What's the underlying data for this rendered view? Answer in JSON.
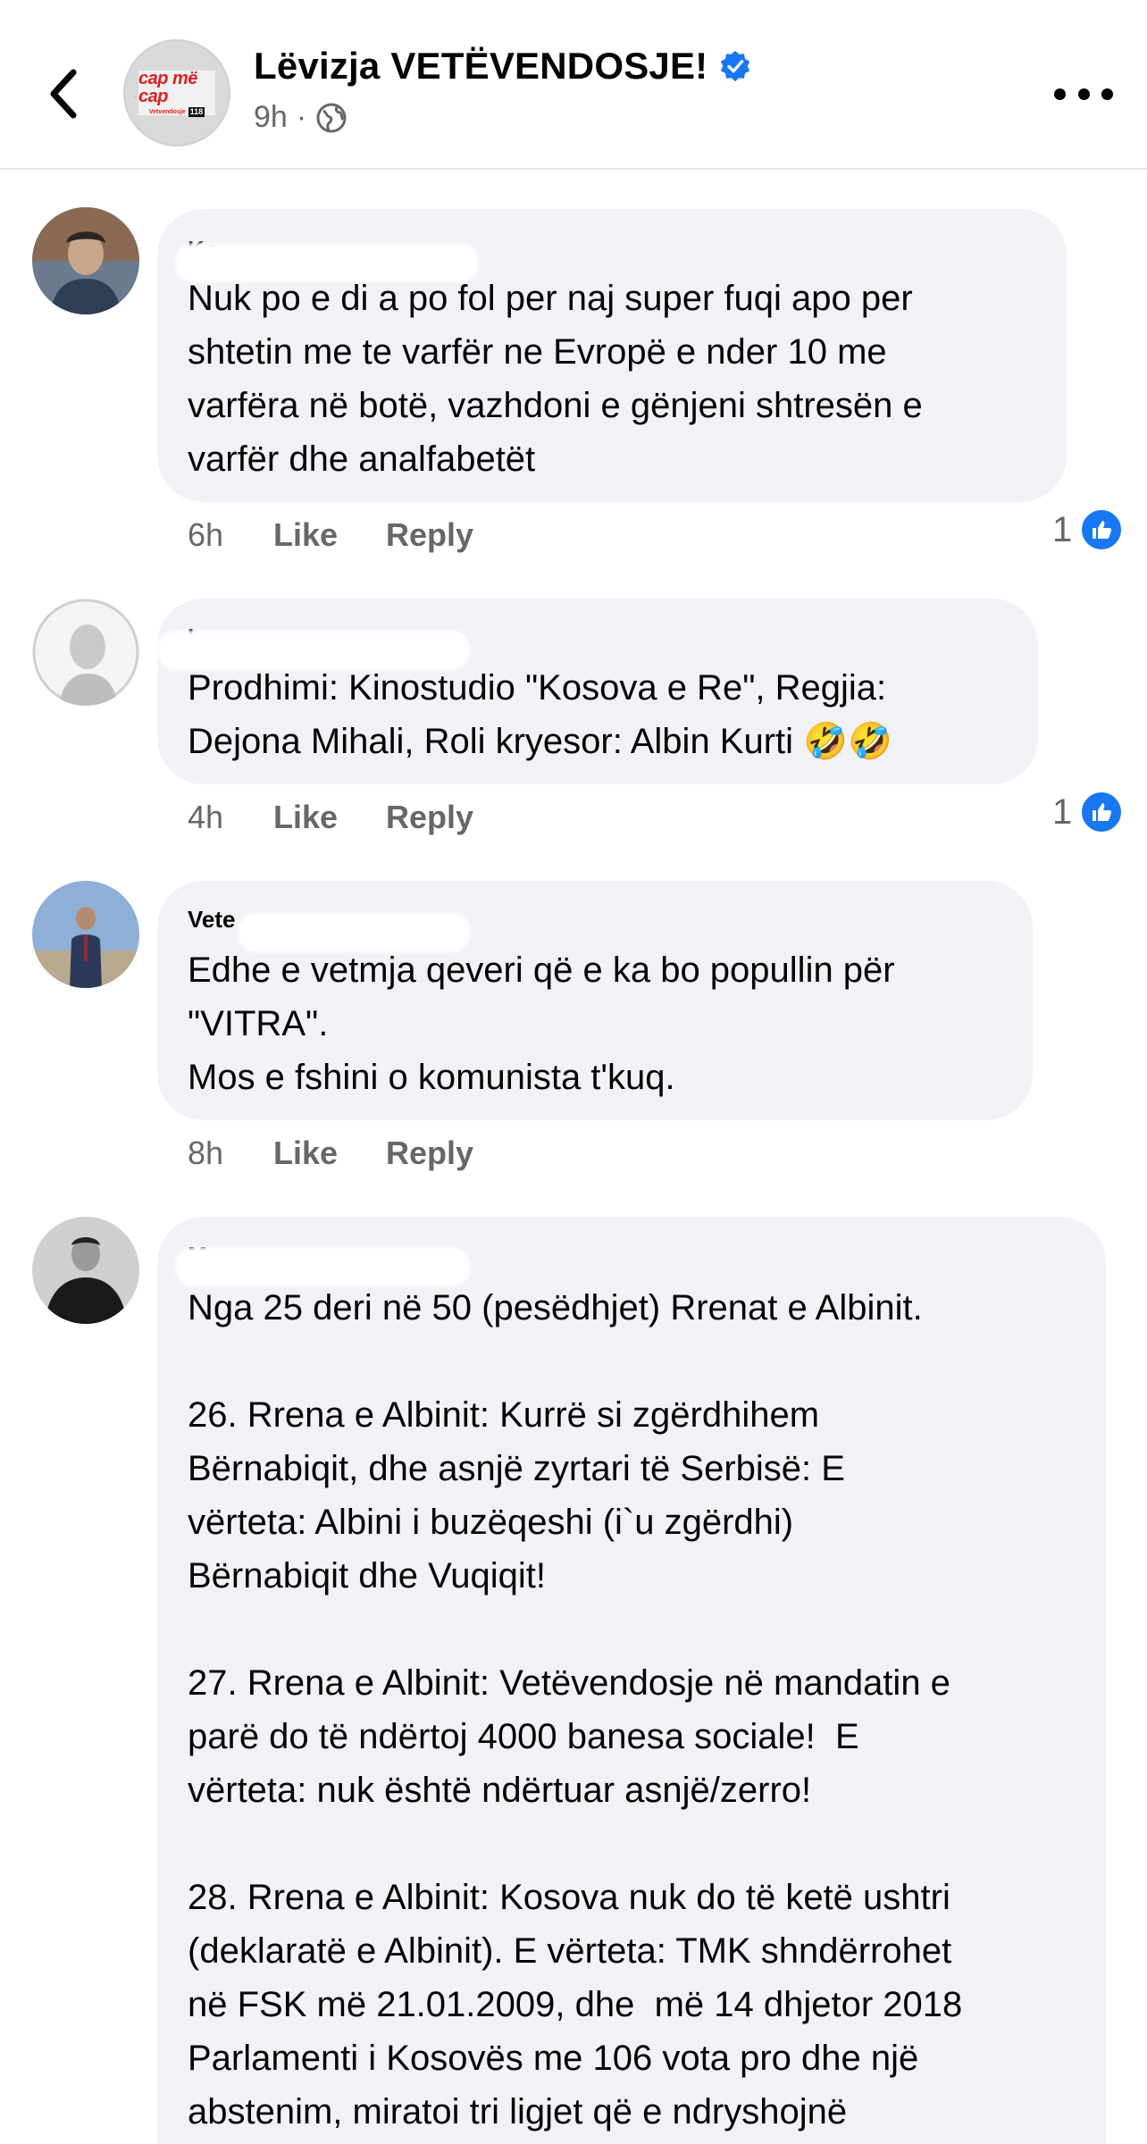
{
  "header": {
    "page_name": "Lëvizja VETËVENDOSJE!",
    "time": "9h",
    "separator": "·",
    "logo_text": "cap më cap",
    "logo_sub": "Vetvendosje",
    "logo_num": "118",
    "icons": {
      "back": "chevron-left-icon",
      "verified": "verified-badge-icon",
      "privacy": "globe-icon",
      "more": "more-dots-icon"
    },
    "accent_color": "#1877f2"
  },
  "comments": [
    {
      "author_visible": "Ko",
      "text": "Nuk po e di a po fol per naj super fuqi apo per\nshtetin me te varfër ne Evropë e nder 10 me\nvarfëra në botë, vazhdoni e gënjeni shtresën e\nvarfër dhe analfabetët",
      "time": "6h",
      "like_label": "Like",
      "reply_label": "Reply",
      "reaction_count": "1"
    },
    {
      "author_visible": "I",
      "text": "Prodhimi: Kinostudio \"Kosova e Re\", Regjia:\nDejona Mihali, Roli kryesor: Albin Kurti 🤣🤣",
      "time": "4h",
      "like_label": "Like",
      "reply_label": "Reply",
      "reaction_count": "1"
    },
    {
      "author_visible": "Vete",
      "text": "Edhe e vetmja qeveri që e ka bo popullin për\n\"VITRA\".\nMos e fshini o komunista t'kuq.",
      "time": "8h",
      "like_label": "Like",
      "reply_label": "Reply"
    },
    {
      "author_visible": "M",
      "text": "Nga 25 deri në 50 (pesëdhjet) Rrenat e Albinit.\n\n26. Rrena e Albinit: Kurrë si zgërdhihem\nBërnabiqit, dhe asnjë zyrtari të Serbisë: E\nvërteta: Albini i buzëqeshi (i`u zgërdhi)\nBërnabiqit dhe Vuqiqit!\n\n27. Rrena e Albinit: Vetëvendosje në mandatin e\nparë do të ndërtoj 4000 banesa sociale!  E\nvërteta: nuk është ndërtuar asnjë/zerro!\n\n28. Rrena e Albinit: Kosova nuk do të ketë ushtri\n(deklaratë e Albinit). E vërteta: TMK shndërrohet\nnë FSK më 21.01.2009, dhe  më 14 dhjetor 2018\nParlamenti i Kosovës me 106 vota pro dhe një\nabstenim, miratoi tri ligjet që e ndryshojnë"
    }
  ]
}
